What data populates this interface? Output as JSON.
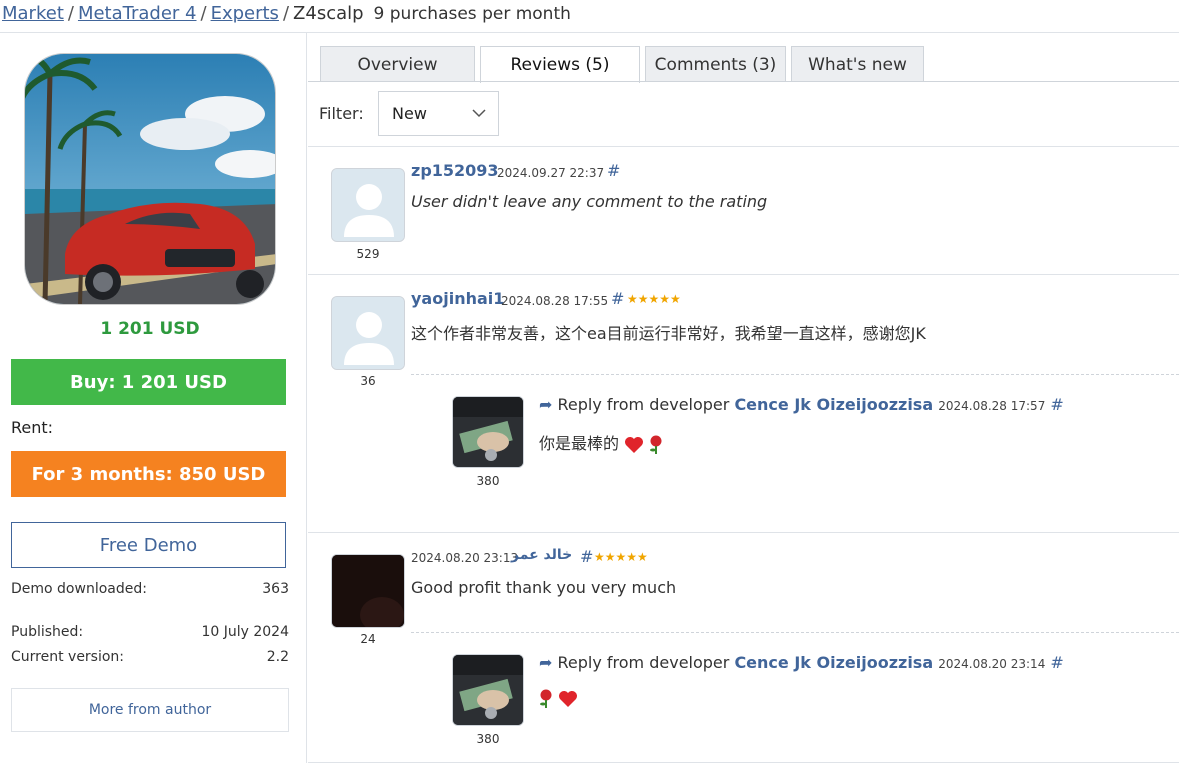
{
  "breadcrumb": {
    "market": "Market",
    "platform": "MetaTrader 4",
    "category": "Experts",
    "product": "Z4scalp",
    "purchases": "9 purchases per month"
  },
  "product": {
    "price": "1 201 USD",
    "buy_label": "Buy: 1 201 USD",
    "rent_label": "Rent:",
    "rent_button": "For 3 months: 850 USD",
    "demo_button": "Free Demo",
    "demo_downloaded_label": "Demo downloaded:",
    "demo_downloaded_value": "363",
    "published_label": "Published:",
    "published_value": "10 July 2024",
    "version_label": "Current version:",
    "version_value": "2.2",
    "more_author": "More from author"
  },
  "tabs": [
    {
      "label": "Overview",
      "active": false
    },
    {
      "label": "Reviews (5)",
      "active": true
    },
    {
      "label": "Comments (3)",
      "active": false
    },
    {
      "label": "What's new",
      "active": false
    }
  ],
  "filter": {
    "label": "Filter:",
    "value": "New"
  },
  "reviews": [
    {
      "user": "zp152093",
      "date": "2024.09.27 22:37",
      "hash": "#",
      "rating": 0,
      "text": "User didn't leave any comment to the rating",
      "avatar_number": "529"
    },
    {
      "user": "yaojinhai1",
      "date": "2024.08.28 17:55",
      "hash": "#",
      "rating": 5,
      "stars": "★★★★★",
      "text": "这个作者非常友善，这个ea目前运行非常好，我希望一直这样，感谢您JK",
      "avatar_number": "36",
      "reply": {
        "prefix": "Reply from developer",
        "developer": "Cence Jk Oizeijoozzisa",
        "date": "2024.08.28 17:57",
        "hash": "#",
        "text": "你是最棒的",
        "avatar_number": "380"
      }
    },
    {
      "user": "خالد عمر",
      "date": "2024.08.20 23:13",
      "hash": "#",
      "rating": 5,
      "stars": "★★★★★",
      "text": "Good profit thank you very much",
      "avatar_number": "24",
      "reply": {
        "prefix": "Reply from developer",
        "developer": "Cence Jk Oizeijoozzisa",
        "date": "2024.08.20 23:14",
        "hash": "#",
        "text": "",
        "avatar_number": "380"
      }
    }
  ],
  "colors": {
    "link": "#41659a",
    "buy": "#42b849",
    "rent": "#f58220",
    "price": "#2e9a3e",
    "stars": "#f0a500"
  }
}
